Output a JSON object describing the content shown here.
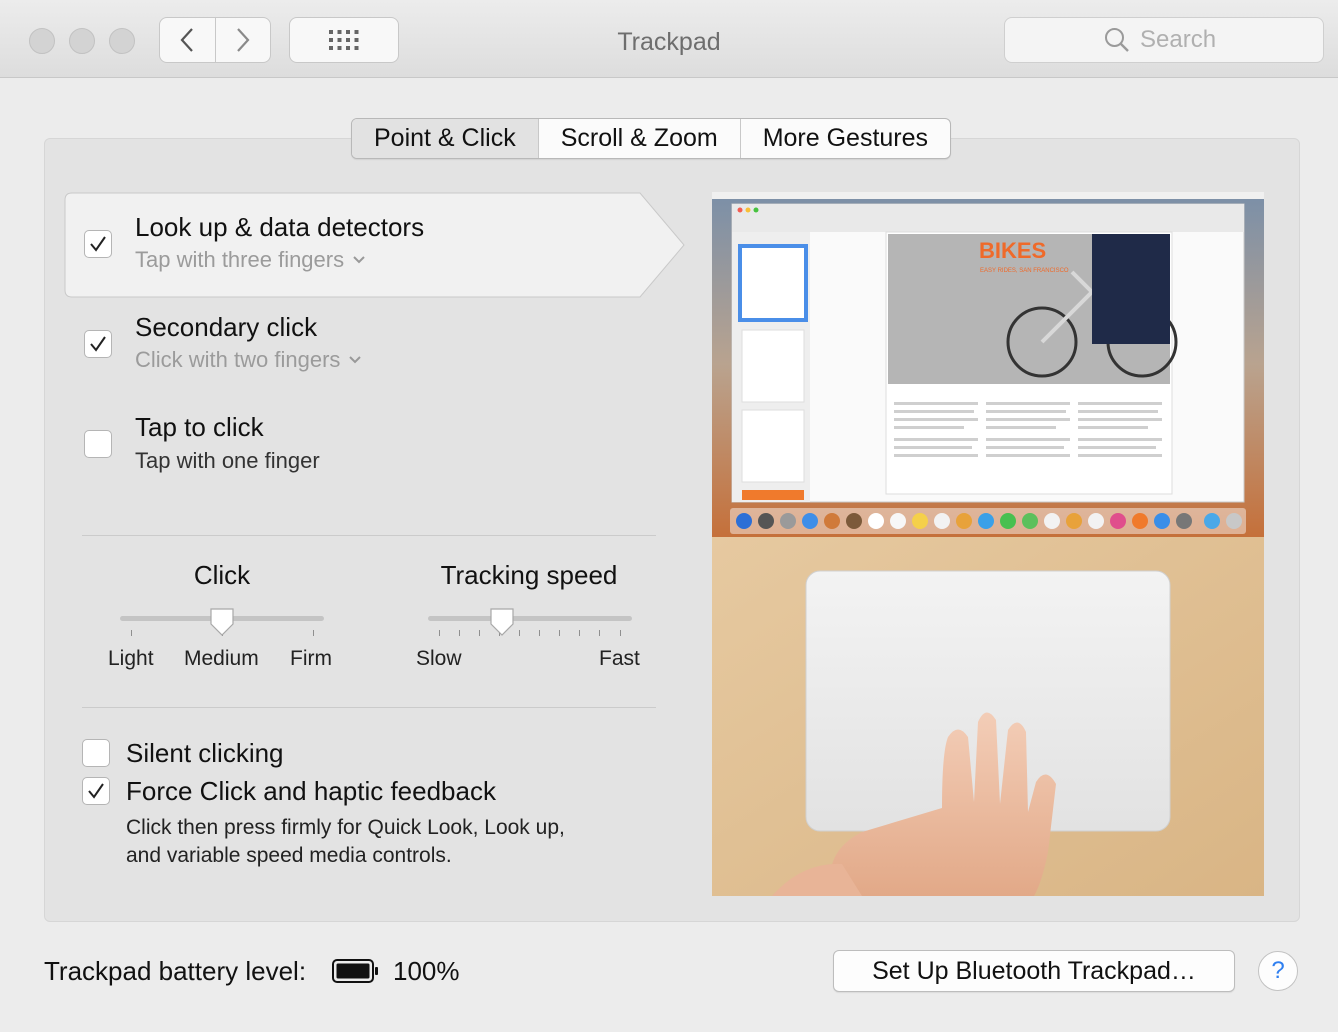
{
  "window": {
    "title": "Trackpad",
    "search_placeholder": "Search"
  },
  "tabs": [
    {
      "label": "Point & Click",
      "active": true
    },
    {
      "label": "Scroll & Zoom",
      "active": false
    },
    {
      "label": "More Gestures",
      "active": false
    }
  ],
  "options": {
    "lookup": {
      "title": "Look up & data detectors",
      "subtitle": "Tap with three fingers",
      "checked": true
    },
    "secondary": {
      "title": "Secondary click",
      "subtitle": "Click with two fingers",
      "checked": true
    },
    "tap": {
      "title": "Tap to click",
      "subtitle": "Tap with one finger",
      "checked": false
    }
  },
  "click_slider": {
    "title": "Click",
    "labels": [
      "Light",
      "Medium",
      "Firm"
    ],
    "value": "Medium"
  },
  "tracking_slider": {
    "title": "Tracking speed",
    "min_label": "Slow",
    "max_label": "Fast",
    "value_fraction": 0.35
  },
  "bottom_options": {
    "silent": {
      "title": "Silent clicking",
      "checked": false
    },
    "force": {
      "title": "Force Click and haptic feedback",
      "checked": true,
      "description_line1": "Click then press firmly for Quick Look, Look up,",
      "description_line2": "and variable speed media controls."
    }
  },
  "preview_doc": {
    "heading": "BIKES",
    "tagline": "EASY RIDES, SAN FRANCISCO"
  },
  "footer": {
    "battery_label": "Trackpad battery level:",
    "battery_value": "100%",
    "setup_button": "Set Up Bluetooth Trackpad…",
    "help_symbol": "?"
  },
  "colors": {
    "accent": "#2f7ff0",
    "checkmark": "#222222"
  }
}
